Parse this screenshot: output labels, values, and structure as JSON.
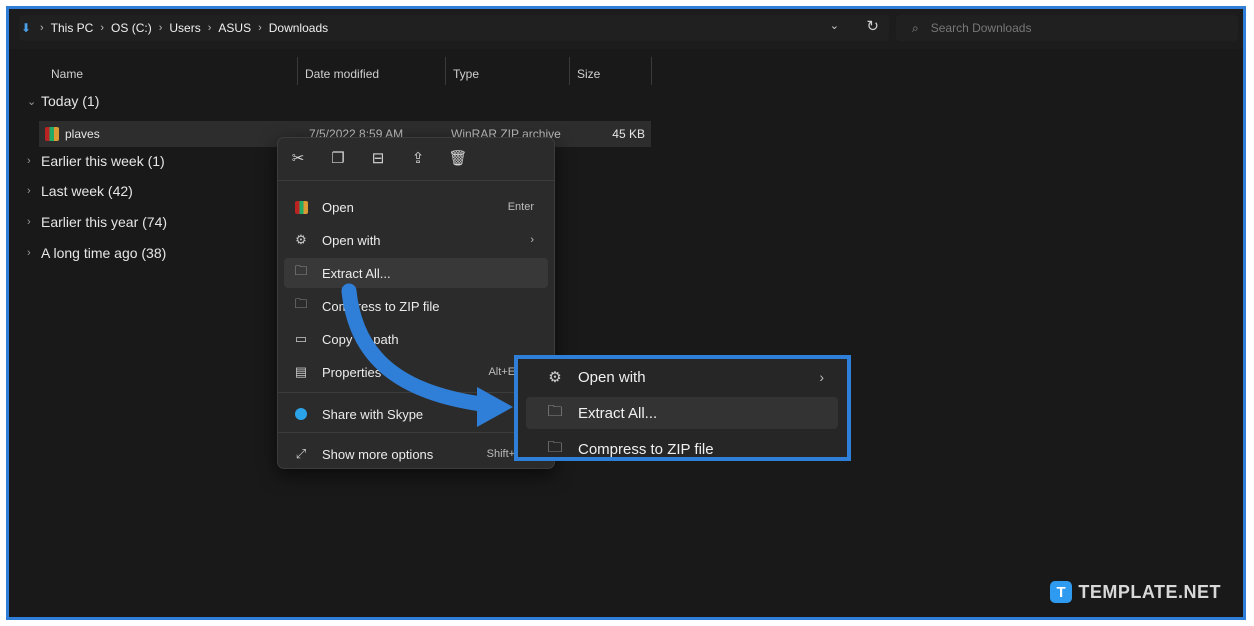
{
  "address_bar": {
    "breadcrumbs": [
      "This PC",
      "OS (C:)",
      "Users",
      "ASUS",
      "Downloads"
    ],
    "search_placeholder": "Search Downloads"
  },
  "columns": {
    "name": "Name",
    "date_modified": "Date modified",
    "type": "Type",
    "size": "Size"
  },
  "groups": [
    {
      "label": "Today (1)",
      "expanded": true
    },
    {
      "label": "Earlier this week (1)",
      "expanded": false
    },
    {
      "label": "Last week (42)",
      "expanded": false
    },
    {
      "label": "Earlier this year (74)",
      "expanded": false
    },
    {
      "label": "A long time ago (38)",
      "expanded": false
    }
  ],
  "file": {
    "name": "plaves",
    "date": "7/5/2022 8:59 AM",
    "type": "WinRAR ZIP archive",
    "size": "45 KB"
  },
  "context_menu": {
    "toolbar_icons": [
      "cut-icon",
      "copy-icon",
      "rename-icon",
      "share-icon",
      "delete-icon"
    ],
    "items": [
      {
        "label": "Open",
        "shortcut": "Enter",
        "icon": "winrar-icon"
      },
      {
        "label": "Open with",
        "shortcut": "›",
        "icon": "open-with-icon"
      },
      {
        "label": "Extract All...",
        "shortcut": "",
        "icon": "extract-icon"
      },
      {
        "label": "Compress to ZIP file",
        "shortcut": "",
        "icon": "zip-folder-icon"
      },
      {
        "label": "Copy as path",
        "shortcut": "",
        "icon": "copy-path-icon"
      },
      {
        "label": "Properties",
        "shortcut": "Alt+Enter",
        "icon": "properties-icon"
      },
      {
        "label": "Share with Skype",
        "shortcut": "",
        "icon": "skype-icon"
      },
      {
        "label": "Show more options",
        "shortcut": "Shift+F10",
        "icon": "more-options-icon"
      }
    ]
  },
  "zoom_callout": {
    "items": [
      {
        "label": "Open with",
        "shortcut": "›"
      },
      {
        "label": "Extract All...",
        "shortcut": ""
      },
      {
        "label": "Compress to ZIP file",
        "shortcut": ""
      }
    ]
  },
  "watermark": {
    "logo": "T",
    "text": "TEMPLATE.NET"
  },
  "colors": {
    "accent": "#2f7fd8",
    "background": "#191919",
    "menu": "#2b2b2b"
  }
}
